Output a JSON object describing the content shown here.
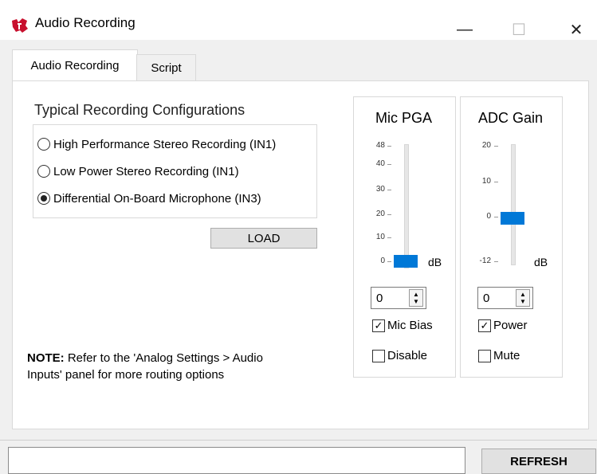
{
  "window": {
    "title": "Audio Recording",
    "minimize_glyph": "—",
    "maximize_glyph": "☐",
    "close_glyph": "✕",
    "logo_icon": "ti-logo-icon",
    "logo_color": "#c8102e"
  },
  "tabs": [
    {
      "label": "Audio Recording",
      "active": true
    },
    {
      "label": "Script",
      "active": false
    }
  ],
  "configs": {
    "title": "Typical Recording Configurations",
    "options": [
      {
        "label": "High Performance Stereo Recording (IN1)",
        "selected": false
      },
      {
        "label": "Low Power Stereo Recording (IN1)",
        "selected": false
      },
      {
        "label": "Differential On-Board Microphone (IN3)",
        "selected": true
      }
    ],
    "load_label": "LOAD"
  },
  "note": {
    "bold": "NOTE:",
    "text": " Refer to the 'Analog Settings > Audio Inputs' panel for more routing options"
  },
  "mic_pga": {
    "title": "Mic PGA",
    "ticks": [
      "48",
      "40",
      "30",
      "20",
      "10",
      "0"
    ],
    "unit": "dB",
    "value": "0",
    "level": 0,
    "range": [
      0,
      48
    ],
    "mic_bias_label": "Mic Bias",
    "mic_bias_checked": true,
    "disable_label": "Disable",
    "disable_checked": false
  },
  "adc_gain": {
    "title": "ADC Gain",
    "ticks": [
      "20",
      "10",
      "0",
      "-12"
    ],
    "unit": "dB",
    "value": "0",
    "level": 0,
    "range": [
      -12,
      20
    ],
    "power_label": "Power",
    "power_checked": true,
    "mute_label": "Mute",
    "mute_checked": false
  },
  "bottom": {
    "status_text": "",
    "refresh_label": "REFRESH"
  },
  "colors": {
    "accent": "#0078d7"
  }
}
